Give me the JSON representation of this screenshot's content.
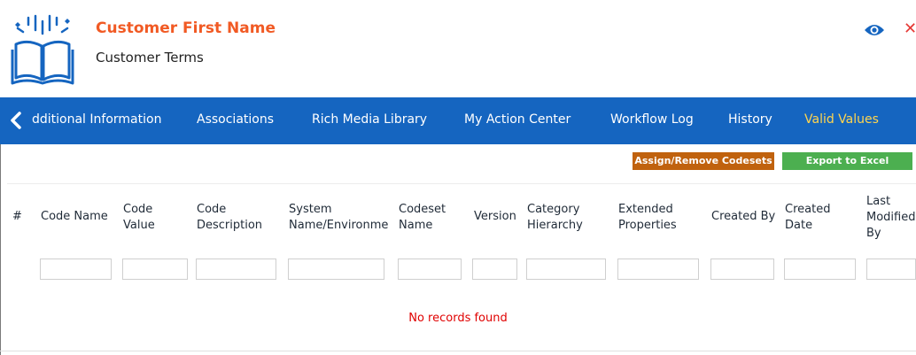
{
  "header": {
    "title": "Customer First Name",
    "subtitle": "Customer Terms",
    "icons": {
      "logo": "open-book-icon",
      "view": "eye-icon",
      "close": "close-icon"
    },
    "colors": {
      "title": "#f15a24",
      "close": "#e53935",
      "eye": "#1565c0"
    }
  },
  "tabs": {
    "scroll_left_icon": "chevron-left-icon",
    "items": [
      {
        "label": "dditional Information"
      },
      {
        "label": "Associations"
      },
      {
        "label": "Rich Media Library"
      },
      {
        "label": "My Action Center"
      },
      {
        "label": "Workflow Log"
      },
      {
        "label": "History"
      },
      {
        "label": "Valid Values",
        "active": true
      }
    ],
    "colors": {
      "background": "#1565c0",
      "active_text": "#ffd54f"
    }
  },
  "toolbar": {
    "assign_label": "Assign/Remove Codesets",
    "export_label": "Export to Excel",
    "colors": {
      "assign": "#c0620e",
      "export": "#4caf50"
    }
  },
  "grid": {
    "columns": [
      {
        "l1": "#",
        "l2": ""
      },
      {
        "l1": "Code Name",
        "l2": ""
      },
      {
        "l1": "Code",
        "l2": "Value"
      },
      {
        "l1": "Code",
        "l2": "Description"
      },
      {
        "l1": "System",
        "l2": "Name/Environme"
      },
      {
        "l1": "Codeset",
        "l2": "Name"
      },
      {
        "l1": "Version",
        "l2": ""
      },
      {
        "l1": "Category",
        "l2": "Hierarchy"
      },
      {
        "l1": "Extended",
        "l2": "Properties"
      },
      {
        "l1": "Created By",
        "l2": ""
      },
      {
        "l1": "Created",
        "l2": "Date"
      },
      {
        "l1": "Last",
        "l2": "Modified",
        "l3": "By"
      }
    ],
    "empty_message": "No records found",
    "empty_color": "#e00000"
  }
}
